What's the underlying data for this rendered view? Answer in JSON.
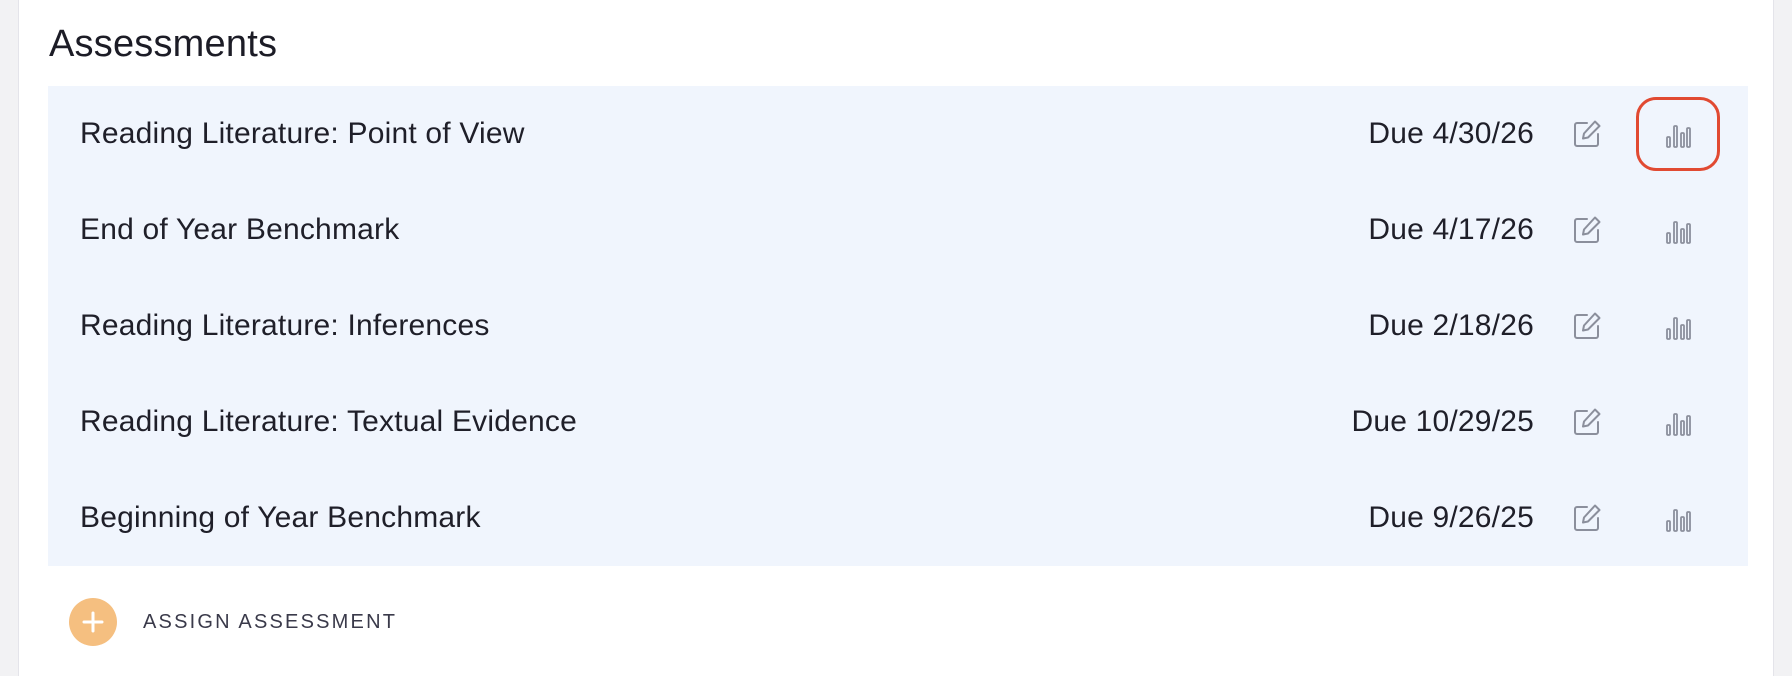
{
  "section": {
    "title": "Assessments"
  },
  "assessments": [
    {
      "title": "Reading Literature: Point of View",
      "due": "Due 4/30/26"
    },
    {
      "title": "End of Year Benchmark",
      "due": "Due 4/17/26"
    },
    {
      "title": "Reading Literature: Inferences",
      "due": "Due 2/18/26"
    },
    {
      "title": "Reading Literature: Textual Evidence",
      "due": "Due 10/29/25"
    },
    {
      "title": "Beginning of Year Benchmark",
      "due": "Due 9/26/25"
    }
  ],
  "assign_button": {
    "label": "ASSIGN ASSESSMENT",
    "icon": "plus-icon"
  },
  "icons": {
    "edit": "edit-icon",
    "report": "bar-chart-icon"
  },
  "colors": {
    "list_background": "#f0f5fd",
    "icon_gray": "#8b8f9c",
    "highlight_outline": "#e14a32",
    "add_circle": "#f5bf80"
  }
}
